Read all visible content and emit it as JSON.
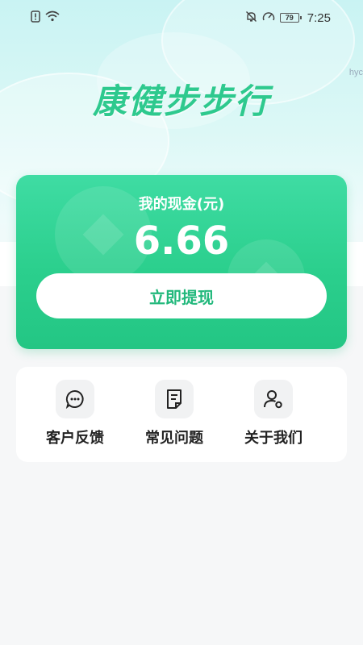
{
  "status_bar": {
    "time": "7:25",
    "battery": "79",
    "left_icons": [
      "sim-alert-icon",
      "wifi-icon"
    ],
    "right_icons": [
      "mute-bell-icon",
      "speedometer-icon",
      "battery-icon"
    ]
  },
  "corner_text": "hyc",
  "app": {
    "title": "康健步步行",
    "title_color": "#2ec98e"
  },
  "cash": {
    "label": "我的现金(元)",
    "amount": "6.66",
    "withdraw_label": "立即提现",
    "card_color": "#2bcf8d"
  },
  "menu": {
    "items": [
      {
        "label": "客户反馈",
        "icon": "chat-bubble-icon"
      },
      {
        "label": "常见问题",
        "icon": "document-icon"
      },
      {
        "label": "关于我们",
        "icon": "user-settings-icon"
      }
    ]
  }
}
